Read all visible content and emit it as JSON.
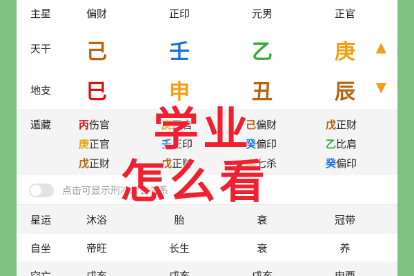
{
  "rows": {
    "main_star": {
      "label": "主星",
      "cells": [
        "偏财",
        "正印",
        "元男",
        "正官"
      ]
    },
    "heavenly_stems": {
      "label": "天干",
      "chars": [
        {
          "char": "己",
          "color": "#b8620a"
        },
        {
          "char": "壬",
          "color": "#1a6fe0"
        },
        {
          "char": "乙",
          "color": "#3aa83a"
        },
        {
          "char": "庚",
          "color": "#f0a010"
        }
      ],
      "arrow": "▲",
      "arrow_color": "#f0a010"
    },
    "earthly_branches": {
      "label": "地支",
      "chars": [
        {
          "char": "巳",
          "color": "#e01010"
        },
        {
          "char": "申",
          "color": "#f0a010"
        },
        {
          "char": "丑",
          "color": "#b8620a"
        },
        {
          "char": "辰",
          "color": "#b8620a"
        }
      ],
      "arrow": "▼",
      "arrow_color": "#f0a010"
    },
    "hidden_stems": {
      "label": "遁藏",
      "columns": [
        [
          {
            "stem": "丙",
            "stem_color": "#e01010",
            "text": "伤官"
          },
          {
            "stem": "庚",
            "stem_color": "#f0a010",
            "text": "正官"
          },
          {
            "stem": "戊",
            "stem_color": "#b8620a",
            "text": "正财"
          }
        ],
        [
          {
            "stem": "庚",
            "stem_color": "#f0a010",
            "text": "正官"
          },
          {
            "stem": "壬",
            "stem_color": "#1a6fe0",
            "text": "正印"
          },
          {
            "stem": "戊",
            "stem_color": "#b8620a",
            "text": "正财"
          }
        ],
        [
          {
            "stem": "己",
            "stem_color": "#b8620a",
            "text": "偏财"
          },
          {
            "stem": "癸",
            "stem_color": "#1a6fe0",
            "text": "偏印"
          },
          {
            "stem": "辛",
            "stem_color": "#f0a010",
            "text": "七杀"
          }
        ],
        [
          {
            "stem": "戊",
            "stem_color": "#b8620a",
            "text": "正财"
          },
          {
            "stem": "乙",
            "stem_color": "#3aa83a",
            "text": "比肩"
          },
          {
            "stem": "癸",
            "stem_color": "#1a6fe0",
            "text": "偏印"
          }
        ]
      ]
    },
    "toggle": {
      "text": "点击可显示刑冲合会关系",
      "on": false
    },
    "star_luck": {
      "label": "星运",
      "cells": [
        "沐浴",
        "胎",
        "衰",
        "冠带"
      ]
    },
    "self_seat": {
      "label": "自坐",
      "cells": [
        "帝旺",
        "长生",
        "衰",
        "养"
      ]
    },
    "empty_death": {
      "label": "空亡",
      "cells": [
        "戌亥",
        "戌亥",
        "戌亥",
        "申酉"
      ]
    }
  },
  "overlay": {
    "line1": "学业",
    "line2": "怎么看",
    "color": "#f02030"
  }
}
